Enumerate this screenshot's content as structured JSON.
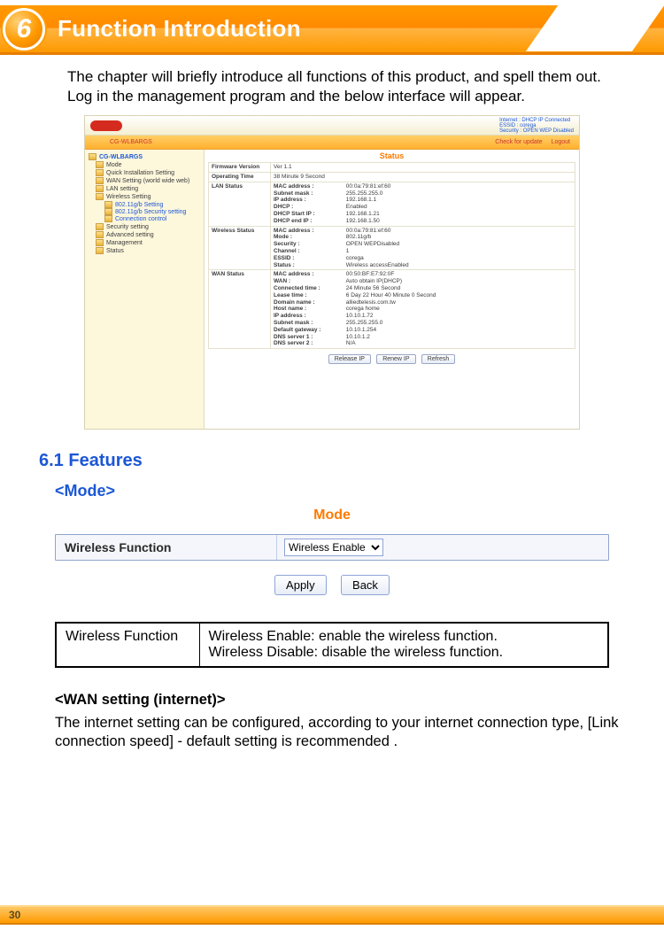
{
  "chapter": {
    "number": "6",
    "title": "Function Introduction"
  },
  "intro": "The chapter will briefly introduce all functions of this product, and spell them out.  Log in the management program and the below interface will appear.",
  "screenshot": {
    "top_status": "Internet : DHCP IP Connected\nESSID : corega\nSecurity : OPEN WEP Disabled",
    "orangebar": {
      "left": "CG-WLBARGS",
      "mid": "Status",
      "btn1": "Check for update",
      "btn2": "Logout"
    },
    "nav": {
      "root": "CG-WLBARGS",
      "items": [
        "Mode",
        "Quick Installation Setting",
        "WAN Setting (world wide web)",
        "LAN setting",
        "Wireless Setting",
        "Security setting",
        "Advanced setting",
        "Management",
        "Status"
      ],
      "sub": [
        "802.11g/b Setting",
        "802.11g/b Security setting",
        "Connection control"
      ]
    },
    "status": {
      "title": "Status",
      "rows": [
        {
          "group": "Firmware Version",
          "lines": [
            {
              "k": "",
              "v": "Ver 1.1"
            }
          ]
        },
        {
          "group": "Operating Time",
          "lines": [
            {
              "k": "",
              "v": "38 Minute 9 Second"
            }
          ]
        },
        {
          "group": "LAN Status",
          "lines": [
            {
              "k": "MAC address :",
              "v": "00:0a:79:81:ef:60"
            },
            {
              "k": "Subnet mask :",
              "v": "255.255.255.0"
            },
            {
              "k": "IP address :",
              "v": "192.168.1.1"
            },
            {
              "k": "DHCP :",
              "v": "Enabled"
            },
            {
              "k": "DHCP Start IP :",
              "v": "192.168.1.21"
            },
            {
              "k": "DHCP end IP :",
              "v": "192.168.1.50"
            }
          ]
        },
        {
          "group": "Wireless Status",
          "lines": [
            {
              "k": "MAC address :",
              "v": "00:0a:79:81:ef:60"
            },
            {
              "k": "Mode :",
              "v": "802.11g/b"
            },
            {
              "k": "Security :",
              "v": "OPEN WEPDisabled"
            },
            {
              "k": "Channel :",
              "v": "1"
            },
            {
              "k": "ESSID :",
              "v": "corega"
            },
            {
              "k": "Status :",
              "v": "Wireless accessEnabled"
            }
          ]
        },
        {
          "group": "WAN Status",
          "lines": [
            {
              "k": "MAC address :",
              "v": "00:50:BF:E7:92:0F"
            },
            {
              "k": "WAN :",
              "v": "Auto obtain IP(DHCP)"
            },
            {
              "k": "Connected time :",
              "v": "24 Minute 56 Second"
            },
            {
              "k": "Lease time :",
              "v": "6 Day 22 Hour 40 Minute 0 Second"
            },
            {
              "k": "Domain name :",
              "v": "alliedtelesis.com.tw"
            },
            {
              "k": "Host name :",
              "v": "corega home"
            },
            {
              "k": "IP address :",
              "v": "10.10.1.72"
            },
            {
              "k": "Subnet mask :",
              "v": "255.255.255.0"
            },
            {
              "k": "Default gateway :",
              "v": "10.10.1.254"
            },
            {
              "k": "DNS server 1 :",
              "v": "10.10.1.2"
            },
            {
              "k": "DNS server 2 :",
              "v": "N/A"
            }
          ]
        }
      ],
      "buttons": [
        "Release IP",
        "Renew IP",
        "Refresh"
      ]
    }
  },
  "section_features": "6.1 Features",
  "mode": {
    "heading": "<Mode>",
    "panel_title": "Mode",
    "label": "Wireless Function",
    "options": [
      "Wireless Enable",
      "Wireless Disable"
    ],
    "selected": "Wireless Enable",
    "apply": "Apply",
    "back": "Back"
  },
  "desc_table": {
    "col1": "Wireless Function",
    "col2_line1": "Wireless Enable: enable the wireless function.",
    "col2_line2": "Wireless Disable: disable the wireless function."
  },
  "wan": {
    "heading": "<WAN setting (internet)>",
    "body": "The internet setting can be configured, according to your internet connection type, [Link connection speed] - default setting is recommended ."
  },
  "page_number": "30"
}
